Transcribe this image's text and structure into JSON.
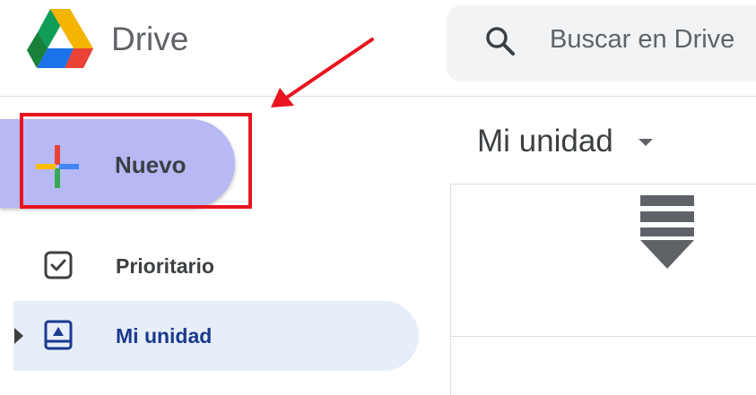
{
  "header": {
    "app_title": "Drive",
    "logo_icon": "google-drive-logo",
    "search": {
      "icon": "search-icon",
      "placeholder": "Buscar en Drive"
    }
  },
  "sidebar": {
    "new_button": {
      "label": "Nuevo",
      "icon": "plus-icon"
    },
    "items": [
      {
        "label": "Prioritario",
        "icon": "checkbox-icon",
        "selected": false
      },
      {
        "label": "Mi unidad",
        "icon": "drive-folder-icon",
        "selected": true
      }
    ]
  },
  "main": {
    "title": "Mi unidad",
    "dropdown_icon": "caret-down-icon",
    "sort_icon": "sort-down-icon"
  },
  "colors": {
    "highlight": "#e8141f",
    "new_button_bg": "#b8b8f4",
    "selected_bg": "#e8eef9",
    "selected_text": "#1a3a8f"
  }
}
